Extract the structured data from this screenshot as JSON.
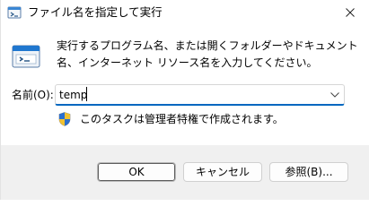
{
  "window": {
    "title": "ファイル名を指定して実行",
    "title_icon": "run-dialog-icon",
    "close_icon": "close-icon"
  },
  "dialog": {
    "description": "実行するプログラム名、または開くフォルダーやドキュメント名、インターネット リソース名を入力してください。",
    "name_label": "名前(O):",
    "name_value": "temp",
    "admin_note": "このタスクは管理者特権で作成されます。",
    "shield_icon": "uac-shield-icon",
    "dropdown_icon": "chevron-down-icon"
  },
  "buttons": {
    "ok": "OK",
    "cancel": "キャンセル",
    "browse": "参照(B)..."
  },
  "colors": {
    "accent": "#0067c0",
    "footer_bg": "#f0f0f0",
    "button_border": "#d0d0d0"
  }
}
